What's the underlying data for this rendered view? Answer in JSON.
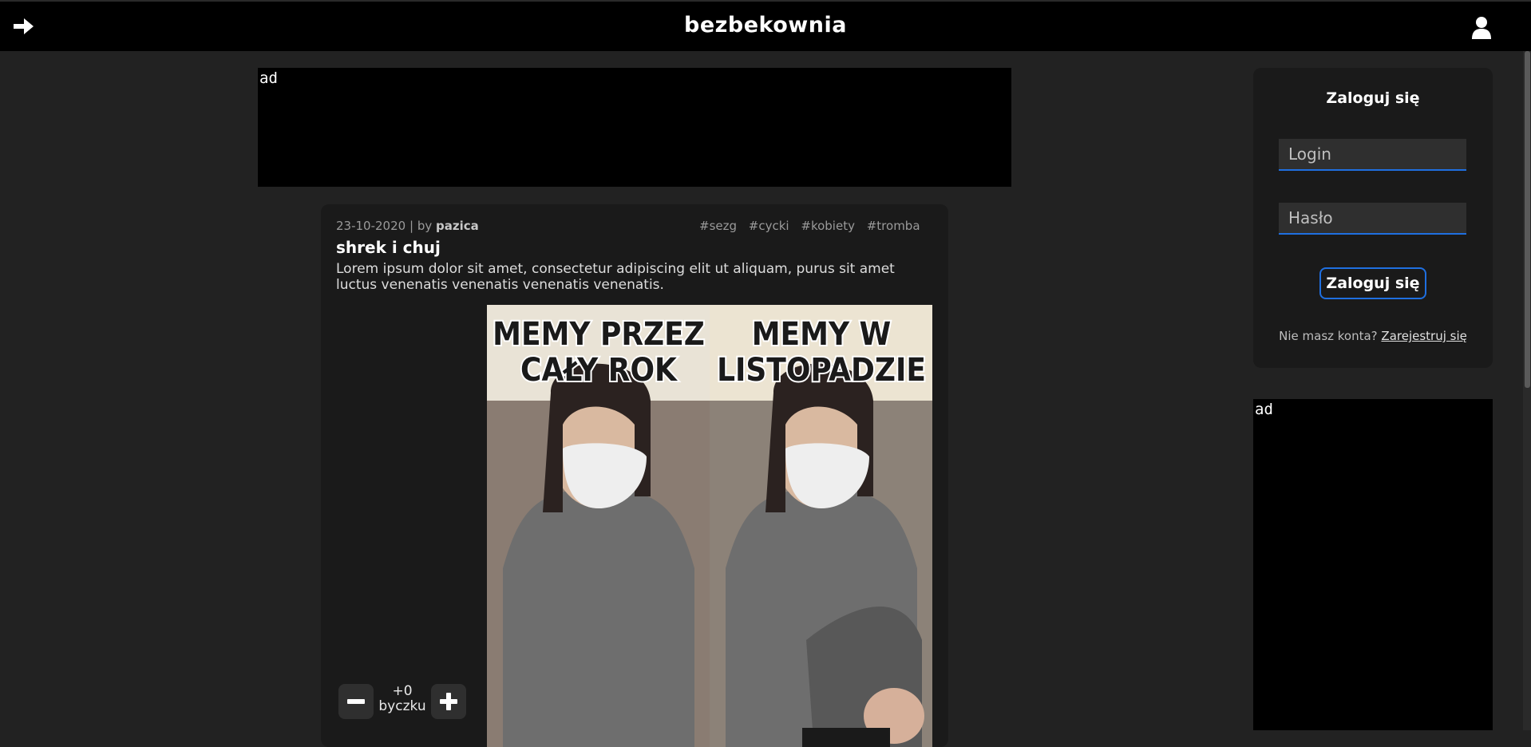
{
  "header": {
    "title": "bezbekownia",
    "back_icon": "arrow-right-icon",
    "user_icon": "user-icon"
  },
  "ads": {
    "top_label": "ad",
    "side_label": "ad"
  },
  "post": {
    "date": "23-10-2020",
    "separator": "|",
    "by_label": "by",
    "author": "pazica",
    "tags": [
      "#sezg",
      "#cycki",
      "#kobiety",
      "#tromba"
    ],
    "title": "shrek i chuj",
    "description": "Lorem ipsum dolor sit amet, consectetur adipiscing elit ut aliquam, purus sit amet luctus venenatis venenatis venenatis venenatis.",
    "image_caption_left_line1": "MEMY PRZEZ",
    "image_caption_left_line2": "CAŁY ROK",
    "image_caption_right_line1": "MEMY W",
    "image_caption_right_line2": "LISTOPADZIE",
    "votes": {
      "count": "+0",
      "unit": "byczku",
      "minus_icon": "minus-icon",
      "plus_icon": "plus-icon"
    }
  },
  "login": {
    "title": "Zaloguj się",
    "login_placeholder": "Login",
    "password_placeholder": "Hasło",
    "submit_label": "Zaloguj się",
    "no_account_text": "Nie masz konta?",
    "register_link": "Zarejestruj się"
  },
  "colors": {
    "accent": "#1f6fe0",
    "background": "#222222",
    "panel": "#1a1a1a"
  }
}
